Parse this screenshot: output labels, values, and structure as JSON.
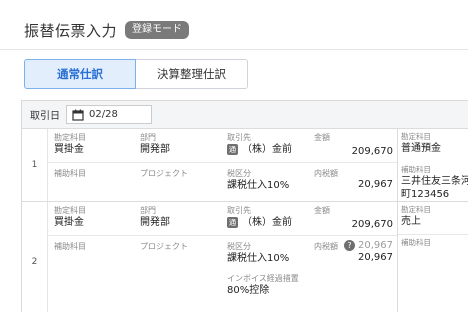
{
  "header": {
    "title": "振替伝票入力",
    "badge": "登録モード"
  },
  "tabs": [
    {
      "label": "通常仕訳",
      "active": true
    },
    {
      "label": "決算整理仕訳",
      "active": false
    }
  ],
  "form": {
    "date_label": "取引日",
    "date_value": "02/28",
    "calendar_icon": "calendar-icon"
  },
  "labels": {
    "account": "勘定科目",
    "department": "部門",
    "partner": "取引先",
    "amount": "金額",
    "sub_account": "補助科目",
    "project": "プロジェクト",
    "tax_category": "税区分",
    "tax_included": "内税額",
    "invoice_measure": "インボイス経過措置",
    "right_account": "勘定科目",
    "right_sub_account": "補助科目"
  },
  "rows": [
    {
      "number": "1",
      "account": "買掛金",
      "department": "開発部",
      "partner_tag": "通",
      "partner": "（株）金前",
      "amount": "209,670",
      "tax_category": "課税仕入10%",
      "tax_amount": "20,967",
      "right_account": "普通預金",
      "right_sub_account_line1": "三井住友三条河",
      "right_sub_account_line2": "町123456"
    },
    {
      "number": "2",
      "account": "買掛金",
      "department": "開発部",
      "partner_tag": "通",
      "partner": "（株）金前",
      "amount": "209,670",
      "tax_category": "課税仕入10%",
      "tax_amount_ref": "20,967",
      "tax_amount": "20,967",
      "invoice_measure": "80%控除",
      "right_account": "売上"
    }
  ]
}
